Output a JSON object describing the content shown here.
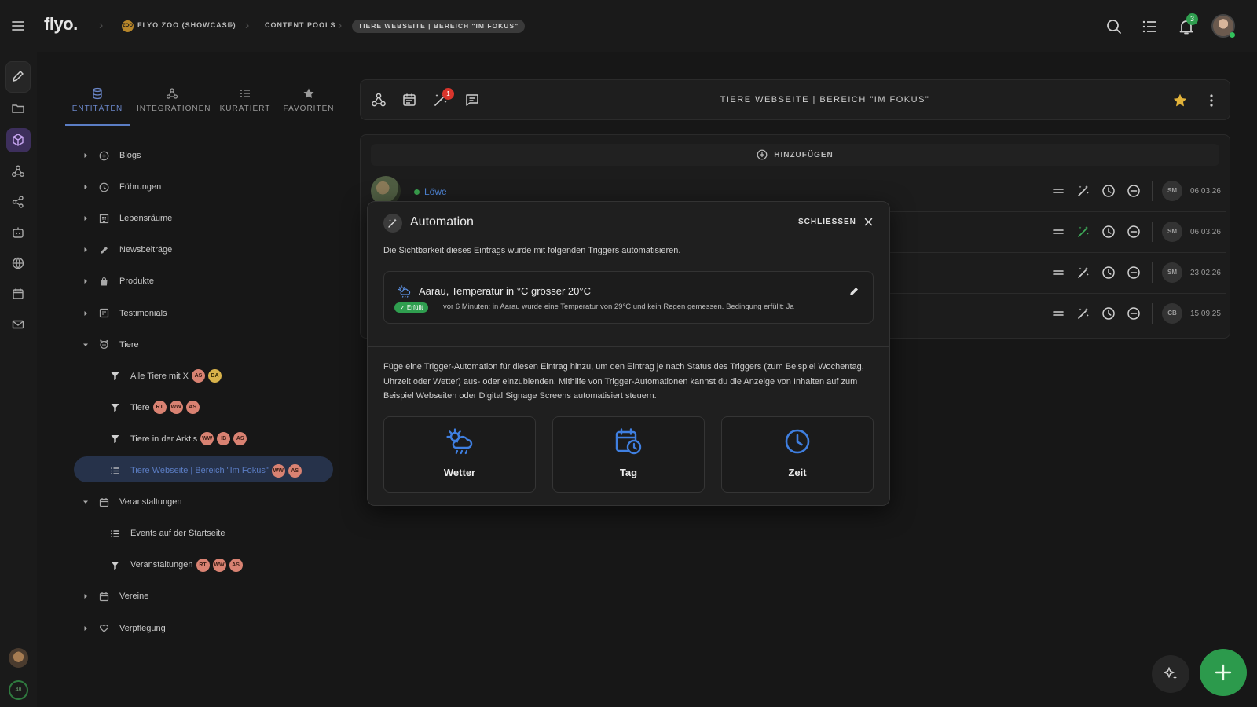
{
  "topbar": {
    "logo": "flyo.",
    "zoo_badge": "ZOO",
    "breadcrumbs": [
      "FLYO ZOO (SHOWCASE)",
      "CONTENT POOLS",
      "TIERE WEBSEITE | BEREICH \"IM FOKUS\""
    ],
    "notification_count": "3",
    "icons": [
      "search-icon",
      "list-icon",
      "bell-icon"
    ]
  },
  "rail": {
    "icons": [
      "edit-icon",
      "folder-icon",
      "cube-icon",
      "integration-icon",
      "share-icon",
      "robot-icon",
      "globe-icon",
      "calendar-icon",
      "mail-icon"
    ],
    "bottom_badge": "48"
  },
  "sidebar": {
    "tabs": [
      {
        "label": "ENTITÄTEN",
        "icon": "database-icon",
        "active": true
      },
      {
        "label": "INTEGRATIONEN",
        "icon": "integration-icon",
        "active": false
      },
      {
        "label": "KURATIERT",
        "icon": "list-icon",
        "active": false
      },
      {
        "label": "FAVORITEN",
        "icon": "star-icon",
        "active": false
      }
    ],
    "tree": [
      {
        "label": "Blogs",
        "icon": "plus-circle-icon",
        "level": 0,
        "expanded": false
      },
      {
        "label": "Führungen",
        "icon": "clock-icon",
        "level": 0,
        "expanded": false
      },
      {
        "label": "Lebensräume",
        "icon": "building-icon",
        "level": 0,
        "expanded": false
      },
      {
        "label": "Newsbeiträge",
        "icon": "pen-icon",
        "level": 0,
        "expanded": false
      },
      {
        "label": "Produkte",
        "icon": "bag-icon",
        "level": 0,
        "expanded": false
      },
      {
        "label": "Testimonials",
        "icon": "quote-box-icon",
        "level": 0,
        "expanded": false
      },
      {
        "label": "Tiere",
        "icon": "animal-icon",
        "level": 0,
        "expanded": true
      },
      {
        "label": "Alle Tiere mit X",
        "icon": "filter-icon",
        "level": 1,
        "chips": [
          {
            "t": "AS",
            "c": "salmon"
          },
          {
            "t": "DA",
            "c": "yellow"
          }
        ]
      },
      {
        "label": "Tiere",
        "icon": "filter-icon",
        "level": 1,
        "chips": [
          {
            "t": "RT",
            "c": "salmon"
          },
          {
            "t": "WW",
            "c": "salmon"
          },
          {
            "t": "AS",
            "c": "salmon"
          }
        ]
      },
      {
        "label": "Tiere in der Arktis",
        "icon": "filter-icon",
        "level": 1,
        "chips": [
          {
            "t": "WW",
            "c": "salmon"
          },
          {
            "t": "IB",
            "c": "salmon"
          },
          {
            "t": "AS",
            "c": "salmon"
          }
        ]
      },
      {
        "label": "Tiere Webseite | Bereich \"Im Fokus\"",
        "icon": "list-icon",
        "level": 1,
        "active": true,
        "chips": [
          {
            "t": "WW",
            "c": "salmon"
          },
          {
            "t": "AS",
            "c": "salmon"
          }
        ]
      },
      {
        "label": "Veranstaltungen",
        "icon": "calendar-icon",
        "level": 0,
        "expanded": true
      },
      {
        "label": "Events auf der Startseite",
        "icon": "list-icon",
        "level": 1
      },
      {
        "label": "Veranstaltungen",
        "icon": "filter-icon",
        "level": 1,
        "chips": [
          {
            "t": "RT",
            "c": "salmon"
          },
          {
            "t": "WW",
            "c": "salmon"
          },
          {
            "t": "AS",
            "c": "salmon"
          }
        ]
      },
      {
        "label": "Vereine",
        "icon": "calendar-icon",
        "level": 0,
        "expanded": false
      },
      {
        "label": "Verpflegung",
        "icon": "heart-icon",
        "level": 0,
        "expanded": false
      }
    ]
  },
  "toolbar": {
    "title": "TIERE WEBSEITE | BEREICH \"IM FOKUS\"",
    "automation_badge": "1"
  },
  "list": {
    "add_label": "HINZUFÜGEN",
    "rows": [
      {
        "title": "Löwe",
        "initials": "SM",
        "date": "06.03.26",
        "automation_active": false
      },
      {
        "title": "",
        "initials": "SM",
        "date": "06.03.26",
        "automation_active": true
      },
      {
        "title": "",
        "initials": "SM",
        "date": "23.02.26",
        "automation_active": false
      },
      {
        "title": "",
        "initials": "CB",
        "date": "15.09.25",
        "automation_active": false
      }
    ]
  },
  "modal": {
    "title": "Automation",
    "close_label": "SCHLIESSEN",
    "description": "Die Sichtbarkeit dieses Eintrags wurde mit folgenden Triggers automatisieren.",
    "trigger": {
      "title": "Aarau, Temperatur in °C grösser 20°C",
      "status_pill": "✓ Erfüllt",
      "status_text": "vor 6 Minuten: in Aarau wurde eine Temperatur von 29°C und kein Regen gemessen. Bedingung erfüllt: Ja"
    },
    "help": "Füge eine Trigger-Automation für diesen Eintrag hinzu, um den Eintrag je nach Status des Triggers (zum Beispiel Wochentag, Uhrzeit oder Wetter) aus- oder einzublenden. Mithilfe von Trigger-Automationen kannst du die Anzeige von Inhalten auf zum Beispiel Webseiten oder Digital Signage Screens automatisiert steuern.",
    "options": [
      {
        "label": "Wetter",
        "icon": "weather-icon"
      },
      {
        "label": "Tag",
        "icon": "calendar-clock-icon"
      },
      {
        "label": "Zeit",
        "icon": "clock-icon"
      }
    ]
  },
  "colors": {
    "accent_blue": "#4f86d8",
    "success_green": "#2f9e4f",
    "danger_red": "#d9352c",
    "star_yellow": "#e2b33a"
  }
}
